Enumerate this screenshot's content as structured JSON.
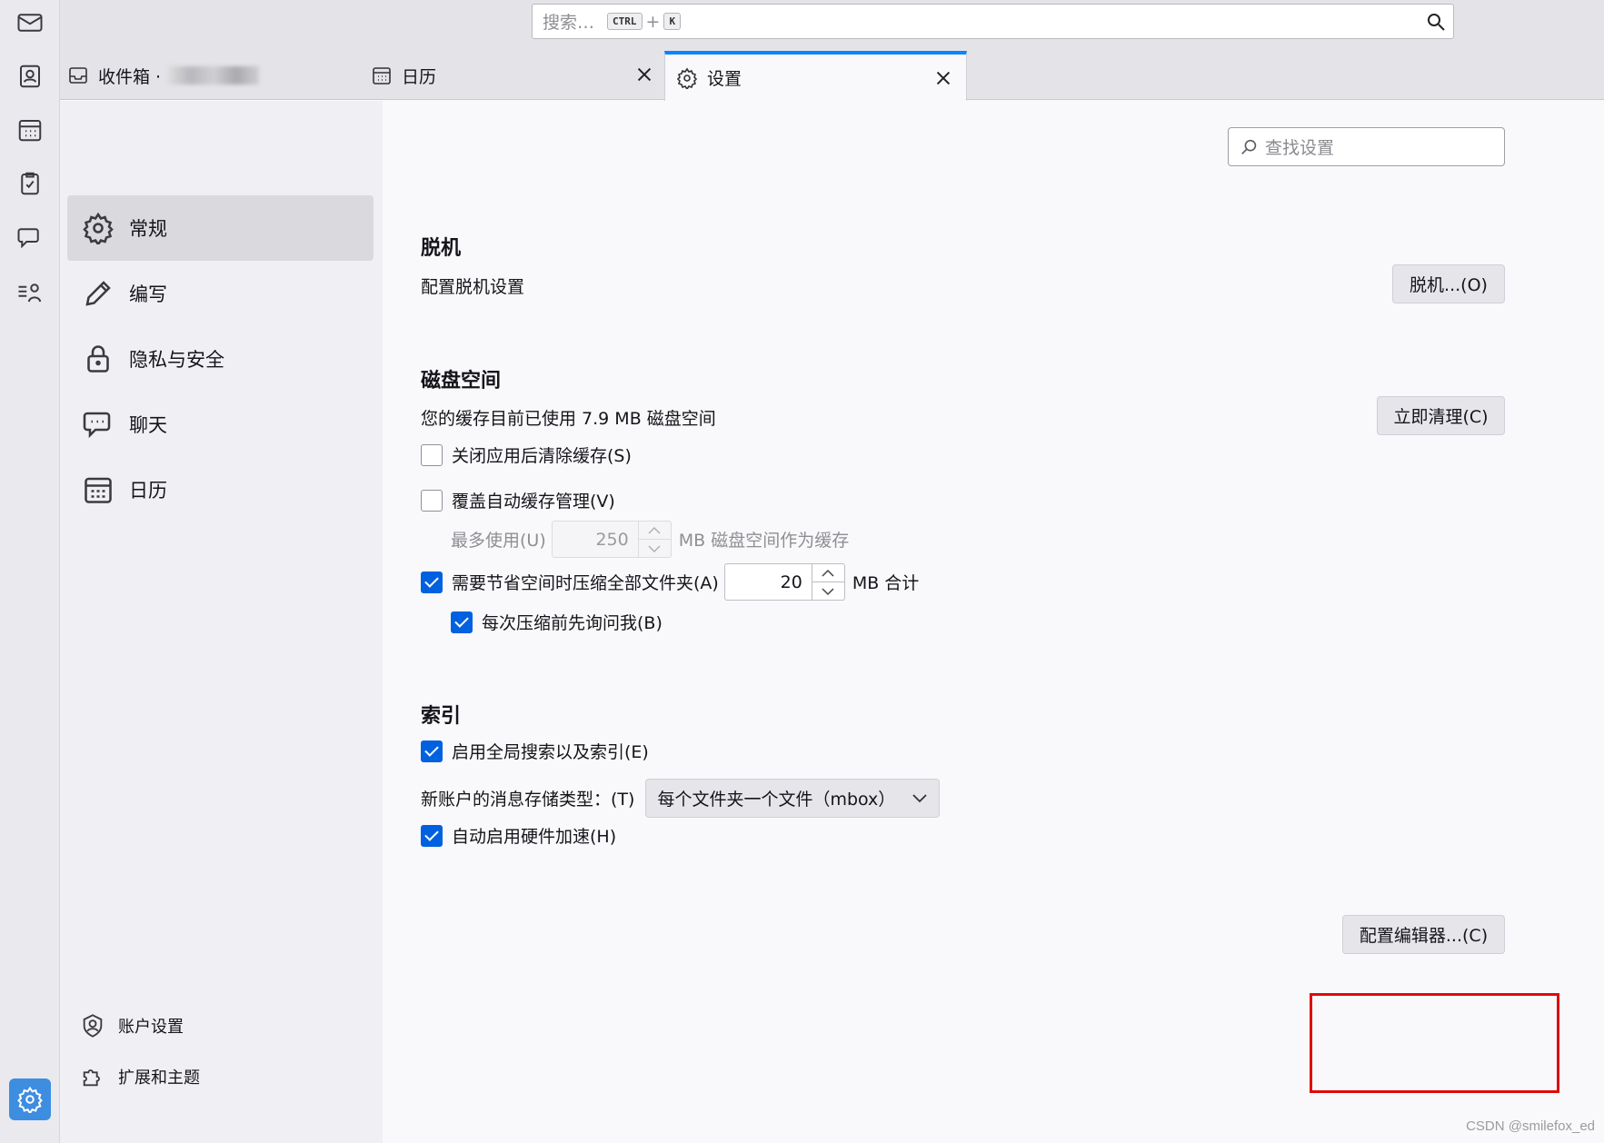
{
  "topbar": {
    "search_placeholder": "搜索…",
    "kbd_ctrl": "CTRL",
    "kbd_plus": "+",
    "kbd_k": "K"
  },
  "tabs": [
    {
      "label": "收件箱 ·",
      "icon": "inbox-icon",
      "active": false
    },
    {
      "label": "日历",
      "icon": "calendar-icon",
      "active": false
    },
    {
      "label": "设置",
      "icon": "gear-icon",
      "active": true
    }
  ],
  "nav": {
    "items": [
      {
        "label": "常规",
        "icon": "gear-icon",
        "selected": true
      },
      {
        "label": "编写",
        "icon": "pencil-icon",
        "selected": false
      },
      {
        "label": "隐私与安全",
        "icon": "lock-icon",
        "selected": false
      },
      {
        "label": "聊天",
        "icon": "chat-icon",
        "selected": false
      },
      {
        "label": "日历",
        "icon": "calendar-icon",
        "selected": false
      }
    ],
    "footer": [
      {
        "label": "账户设置",
        "icon": "account-icon"
      },
      {
        "label": "扩展和主题",
        "icon": "puzzle-icon"
      }
    ]
  },
  "content": {
    "find_placeholder": "查找设置",
    "offline": {
      "title": "脱机",
      "desc": "配置脱机设置",
      "button": "脱机...(O)"
    },
    "disk": {
      "title": "磁盘空间",
      "desc": "您的缓存目前已使用 7.9 MB 磁盘空间",
      "clear_button": "立即清理(C)",
      "clear_on_close": "关闭应用后清除缓存(S)",
      "override_cache": "覆盖自动缓存管理(V)",
      "max_use_label": "最多使用(U)",
      "max_use_value": "250",
      "max_use_suffix": "MB 磁盘空间作为缓存",
      "compact_label": "需要节省空间时压缩全部文件夹(A)",
      "compact_value": "20",
      "compact_suffix": "MB 合计",
      "ask_before": "每次压缩前先询问我(B)"
    },
    "indexing": {
      "title": "索引",
      "global_search": "启用全局搜索以及索引(E)",
      "storage_label": "新账户的消息存储类型：(T)",
      "storage_value": "每个文件夹一个文件（mbox）",
      "hw_accel": "自动启用硬件加速(H)"
    },
    "config_editor_button": "配置编辑器...(C)"
  },
  "watermark": "CSDN @smilefox_ed",
  "colors": {
    "accent": "#0061e0",
    "highlight": "#e00a0a",
    "tab_active_border": "#0a84ff"
  }
}
